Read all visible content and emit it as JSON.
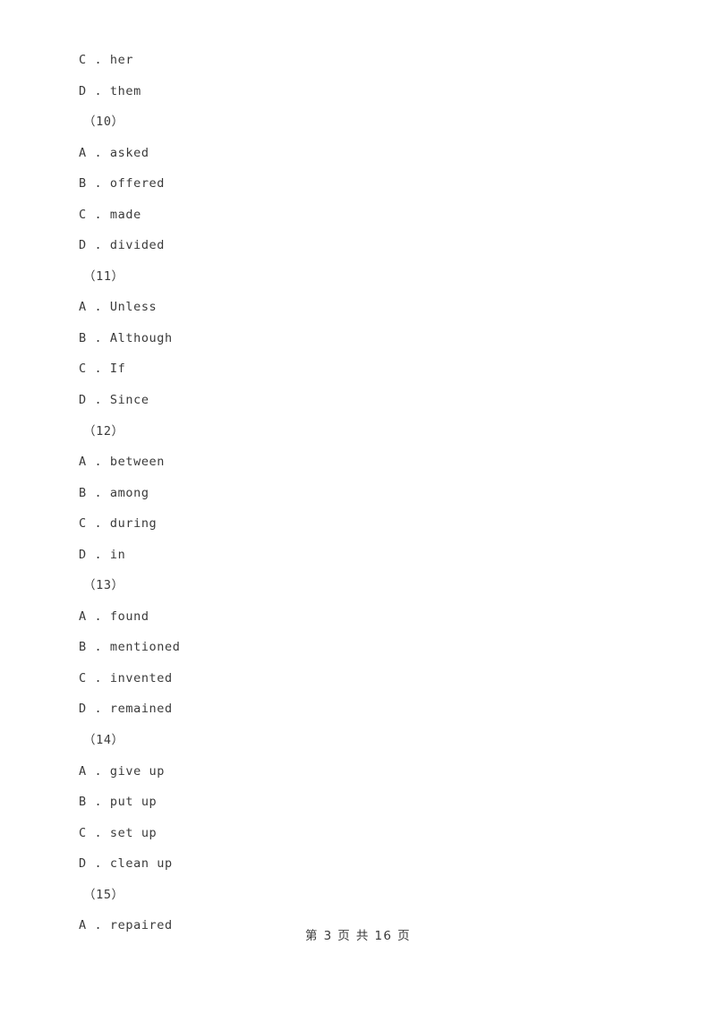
{
  "document": {
    "type": "exam-worksheet",
    "language": "zh-CN",
    "background_color": "#ffffff",
    "text_color": "#3a3a3a"
  },
  "body": {
    "lines": [
      {
        "kind": "option",
        "text": "C . her"
      },
      {
        "kind": "option",
        "text": "D . them"
      },
      {
        "kind": "qnum",
        "text": "（10）"
      },
      {
        "kind": "option",
        "text": "A . asked"
      },
      {
        "kind": "option",
        "text": "B . offered"
      },
      {
        "kind": "option",
        "text": "C . made"
      },
      {
        "kind": "option",
        "text": "D . divided"
      },
      {
        "kind": "qnum",
        "text": "（11）"
      },
      {
        "kind": "option",
        "text": "A . Unless"
      },
      {
        "kind": "option",
        "text": "B . Although"
      },
      {
        "kind": "option",
        "text": "C . If"
      },
      {
        "kind": "option",
        "text": "D . Since"
      },
      {
        "kind": "qnum",
        "text": "（12）"
      },
      {
        "kind": "option",
        "text": "A . between"
      },
      {
        "kind": "option",
        "text": "B . among"
      },
      {
        "kind": "option",
        "text": "C . during"
      },
      {
        "kind": "option",
        "text": "D . in"
      },
      {
        "kind": "qnum",
        "text": "（13）"
      },
      {
        "kind": "option",
        "text": "A . found"
      },
      {
        "kind": "option",
        "text": "B . mentioned"
      },
      {
        "kind": "option",
        "text": "C . invented"
      },
      {
        "kind": "option",
        "text": "D . remained"
      },
      {
        "kind": "qnum",
        "text": "（14）"
      },
      {
        "kind": "option",
        "text": "A . give up"
      },
      {
        "kind": "option",
        "text": "B . put up"
      },
      {
        "kind": "option",
        "text": "C . set up"
      },
      {
        "kind": "option",
        "text": "D . clean up"
      },
      {
        "kind": "qnum",
        "text": "（15）"
      },
      {
        "kind": "option",
        "text": "A . repaired"
      }
    ]
  },
  "footer": {
    "page_label": "第 3 页 共 16 页",
    "current_page": 3,
    "total_pages": 16
  }
}
